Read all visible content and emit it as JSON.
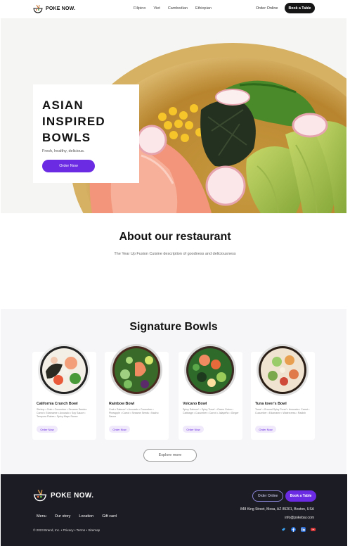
{
  "header": {
    "logo_text": "POKE NOW.",
    "nav": [
      "Filipino",
      "Viet",
      "Cambodian",
      "Ethiopian"
    ],
    "order_online": "Order Online",
    "book_table": "Book a Table"
  },
  "hero": {
    "title": "ASIAN\nINSPIRED\nBOWLS",
    "subtitle": "Fresh, healthy, delicious.",
    "cta": "Order Now"
  },
  "about": {
    "title": "About our restaurant",
    "description": "The Year Up Fusion Cuisine description of goodness and deliciousness"
  },
  "signature": {
    "title": "Signature Bowls",
    "cards": [
      {
        "name": "California Crunch Bowl",
        "desc": "Shrimp • Crab • Cucumber • Sesame Seeds • Carrot • Edamame • Avocado • Soy Sauce • Tempura Flakes • Spicy Mayo Sauce",
        "cta": "Order Now"
      },
      {
        "name": "Rainbow Bowl",
        "desc": "Crab • Salmon* • Avocado • Cucumber • Pineapple • Carrot • Sesame Seeds • Nacho Sauce",
        "cta": "Order Now"
      },
      {
        "name": "Volcano Bowl",
        "desc": "Spicy Salmon* • Spicy Tuna* • Green Onion • Cabbage • Cucumber • Carrot • Jalapeño • Ginger",
        "cta": "Order Now"
      },
      {
        "name": "Tuna lover's Bowl",
        "desc": "Tuna* • Ground Spicy Tuna* • Avocado • Carrot • Cucumber • Edamame • Watercress • Radish",
        "cta": "Order Now"
      }
    ],
    "explore": "Explore more"
  },
  "footer": {
    "logo_text": "POKE NOW.",
    "links": [
      "Menu",
      "Our story",
      "Location",
      "Gift card"
    ],
    "copyright": "© 2023 Brand, Inc. • Privacy • Terms • Sitemap",
    "order_online": "Order Online",
    "book_table": "Book a Table",
    "address": "848 King Street, Mesa, AZ 85201, Boston, USA",
    "email": "info@pokebar.com",
    "social": [
      "twitter-icon",
      "facebook-icon",
      "linkedin-icon",
      "youtube-icon"
    ]
  },
  "colors": {
    "accent": "#6a2be2",
    "footer_bg": "#1c1c24",
    "section_bg": "#f6f6f8"
  }
}
